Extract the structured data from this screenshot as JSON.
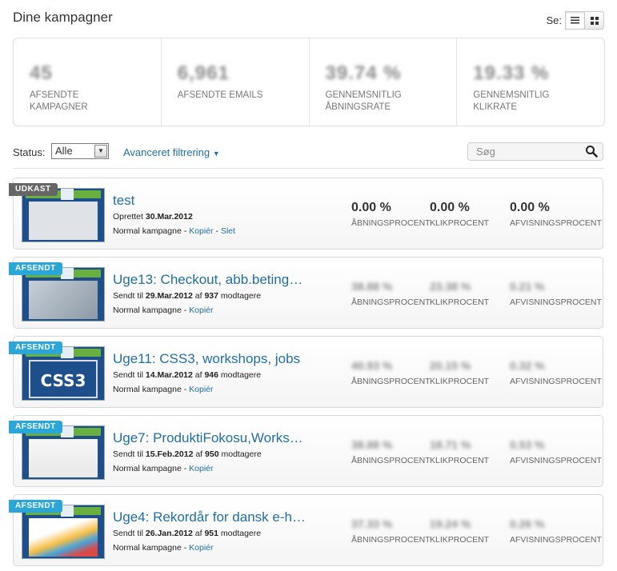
{
  "header": {
    "title": "Dine kampagner",
    "view_label": "Se:",
    "view_options": [
      "list-view",
      "grid-view"
    ]
  },
  "stats": [
    {
      "value": "45",
      "label": "AFSENDTE KAMPAGNER"
    },
    {
      "value": "6,961",
      "label": "AFSENDTE EMAILS"
    },
    {
      "value": "39.74 %",
      "label": "GENNEMSNITLIG ÅBNINGSRATE"
    },
    {
      "value": "19.33 %",
      "label": "GENNEMSNITLIG KLIKRATE"
    }
  ],
  "filters": {
    "status_label": "Status:",
    "status_value": "Alle",
    "advanced_label": "Avanceret filtrering",
    "search_placeholder": "Søg"
  },
  "campaigns": [
    {
      "badge": "UDKAST",
      "title": "test",
      "sub_prefix": "Oprettet",
      "date": "30.Mar.2012",
      "sub_suffix": "",
      "recipients": "",
      "type": "Normal kampagne",
      "link1": "Kopiér",
      "link2": "Slet",
      "open": "0.00 %",
      "click": "0.00 %",
      "bounce": "0.00 %"
    },
    {
      "badge": "AFSENDT",
      "title": "Uge13: Checkout, abb.beting…",
      "sub_prefix": "Sendt til",
      "date": "29.Mar.2012",
      "mid": "af",
      "recipients": "937",
      "sub_suffix": "modtagere",
      "type": "Normal kampagne",
      "link1": "Kopiér",
      "open": "38.88 %",
      "click": "23.38 %",
      "bounce": "0.21 %"
    },
    {
      "badge": "AFSENDT",
      "title": "Uge11: CSS3, workshops, jobs",
      "sub_prefix": "Sendt til",
      "date": "14.Mar.2012",
      "mid": "af",
      "recipients": "946",
      "sub_suffix": "modtagere",
      "type": "Normal kampagne",
      "link1": "Kopiér",
      "open": "40.93 %",
      "click": "20.15 %",
      "bounce": "0.32 %"
    },
    {
      "badge": "AFSENDT",
      "title": "Uge7: ProduktiFokosu,Works…",
      "sub_prefix": "Sendt til",
      "date": "15.Feb.2012",
      "mid": "af",
      "recipients": "950",
      "sub_suffix": "modtagere",
      "type": "Normal kampagne",
      "link1": "Kopiér",
      "open": "38.88 %",
      "click": "18.71 %",
      "bounce": "0.53 %"
    },
    {
      "badge": "AFSENDT",
      "title": "Uge4: Rekordår for dansk e-h…",
      "sub_prefix": "Sendt til",
      "date": "26.Jan.2012",
      "mid": "af",
      "recipients": "951",
      "sub_suffix": "modtagere",
      "type": "Normal kampagne",
      "link1": "Kopiér",
      "open": "37.33 %",
      "click": "19.24 %",
      "bounce": "0.26 %"
    }
  ],
  "metric_labels": {
    "open": "ÅBNINGSPROCENT",
    "click": "KLIKPROCENT",
    "bounce": "AFVISNINGSPROCENT"
  }
}
